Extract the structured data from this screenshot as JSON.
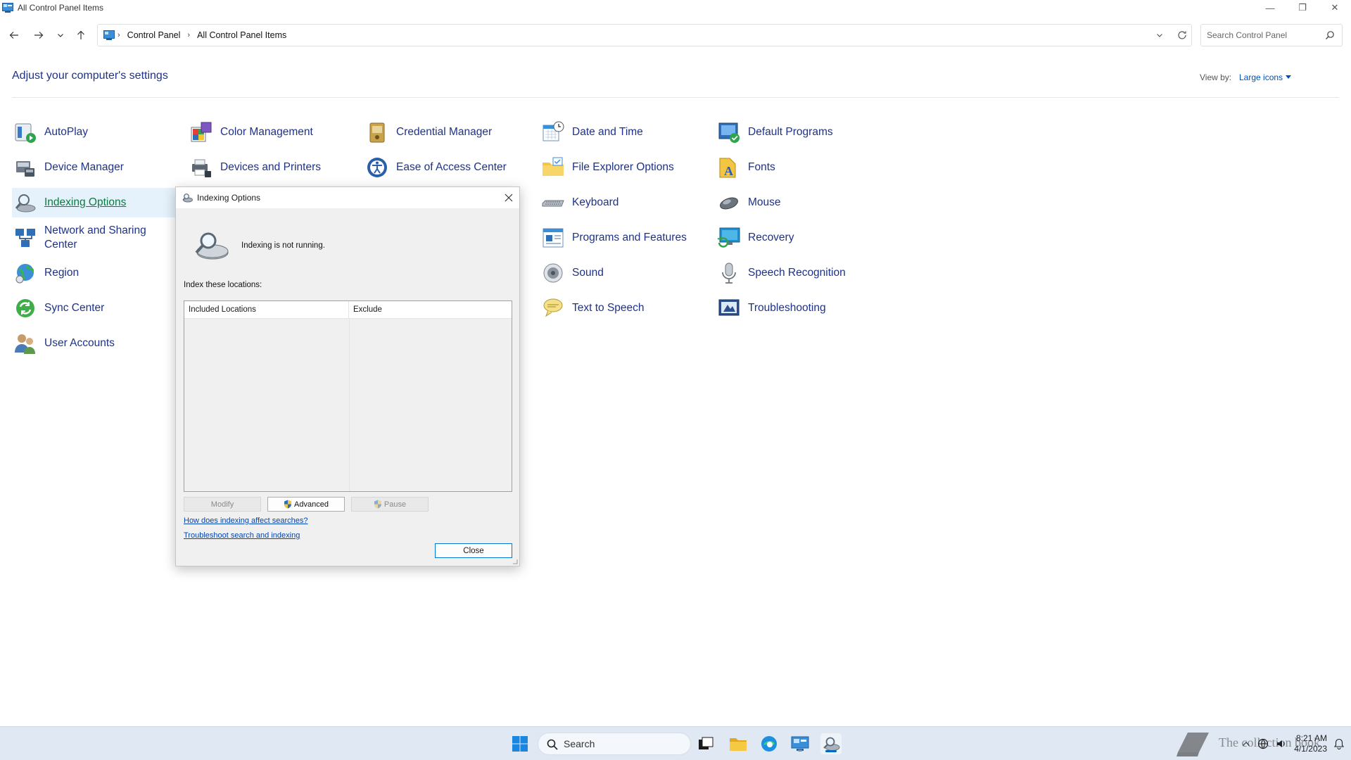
{
  "window": {
    "title": "All Control Panel Items",
    "minimize": "—",
    "restore": "❐",
    "close": "✕"
  },
  "nav": {
    "breadcrumb": [
      "Control Panel",
      "All Control Panel Items"
    ],
    "search_placeholder": "Search Control Panel"
  },
  "header": {
    "title": "Adjust your computer's settings",
    "view_by_label": "View by:",
    "view_by_value": "Large icons"
  },
  "items": {
    "autoplay": "AutoPlay",
    "color_management": "Color Management",
    "credential_manager": "Credential Manager",
    "date_and_time": "Date and Time",
    "default_programs": "Default Programs",
    "device_manager": "Device Manager",
    "devices_and_printers": "Devices and Printers",
    "ease_of_access": "Ease of Access Center",
    "file_explorer_options": "File Explorer Options",
    "fonts": "Fonts",
    "indexing_options": "Indexing Options",
    "keyboard": "Keyboard",
    "mouse": "Mouse",
    "network_sharing": "Network and Sharing Center",
    "programs_features": "Programs and Features",
    "recovery": "Recovery",
    "region": "Region",
    "sound": "Sound",
    "speech_recognition": "Speech Recognition",
    "sync_center": "Sync Center",
    "text_to_speech": "Text to Speech",
    "troubleshooting": "Troubleshooting",
    "user_accounts": "User Accounts"
  },
  "dialog": {
    "title": "Indexing Options",
    "status": "Indexing is not running.",
    "index_label": "Index these locations:",
    "columns": [
      "Included Locations",
      "Exclude"
    ],
    "buttons": {
      "modify": "Modify",
      "advanced": "Advanced",
      "pause": "Pause",
      "close": "Close"
    },
    "links": {
      "how": "How does indexing affect searches?",
      "troubleshoot": "Troubleshoot search and indexing"
    }
  },
  "taskbar": {
    "search": "Search",
    "time": "8:21 AM",
    "date": "4/1/2023",
    "watermark": "The collection book"
  },
  "colors": {
    "link": "#1e3287",
    "accent": "#0078d4",
    "taskbar": "#dfe8f3"
  }
}
